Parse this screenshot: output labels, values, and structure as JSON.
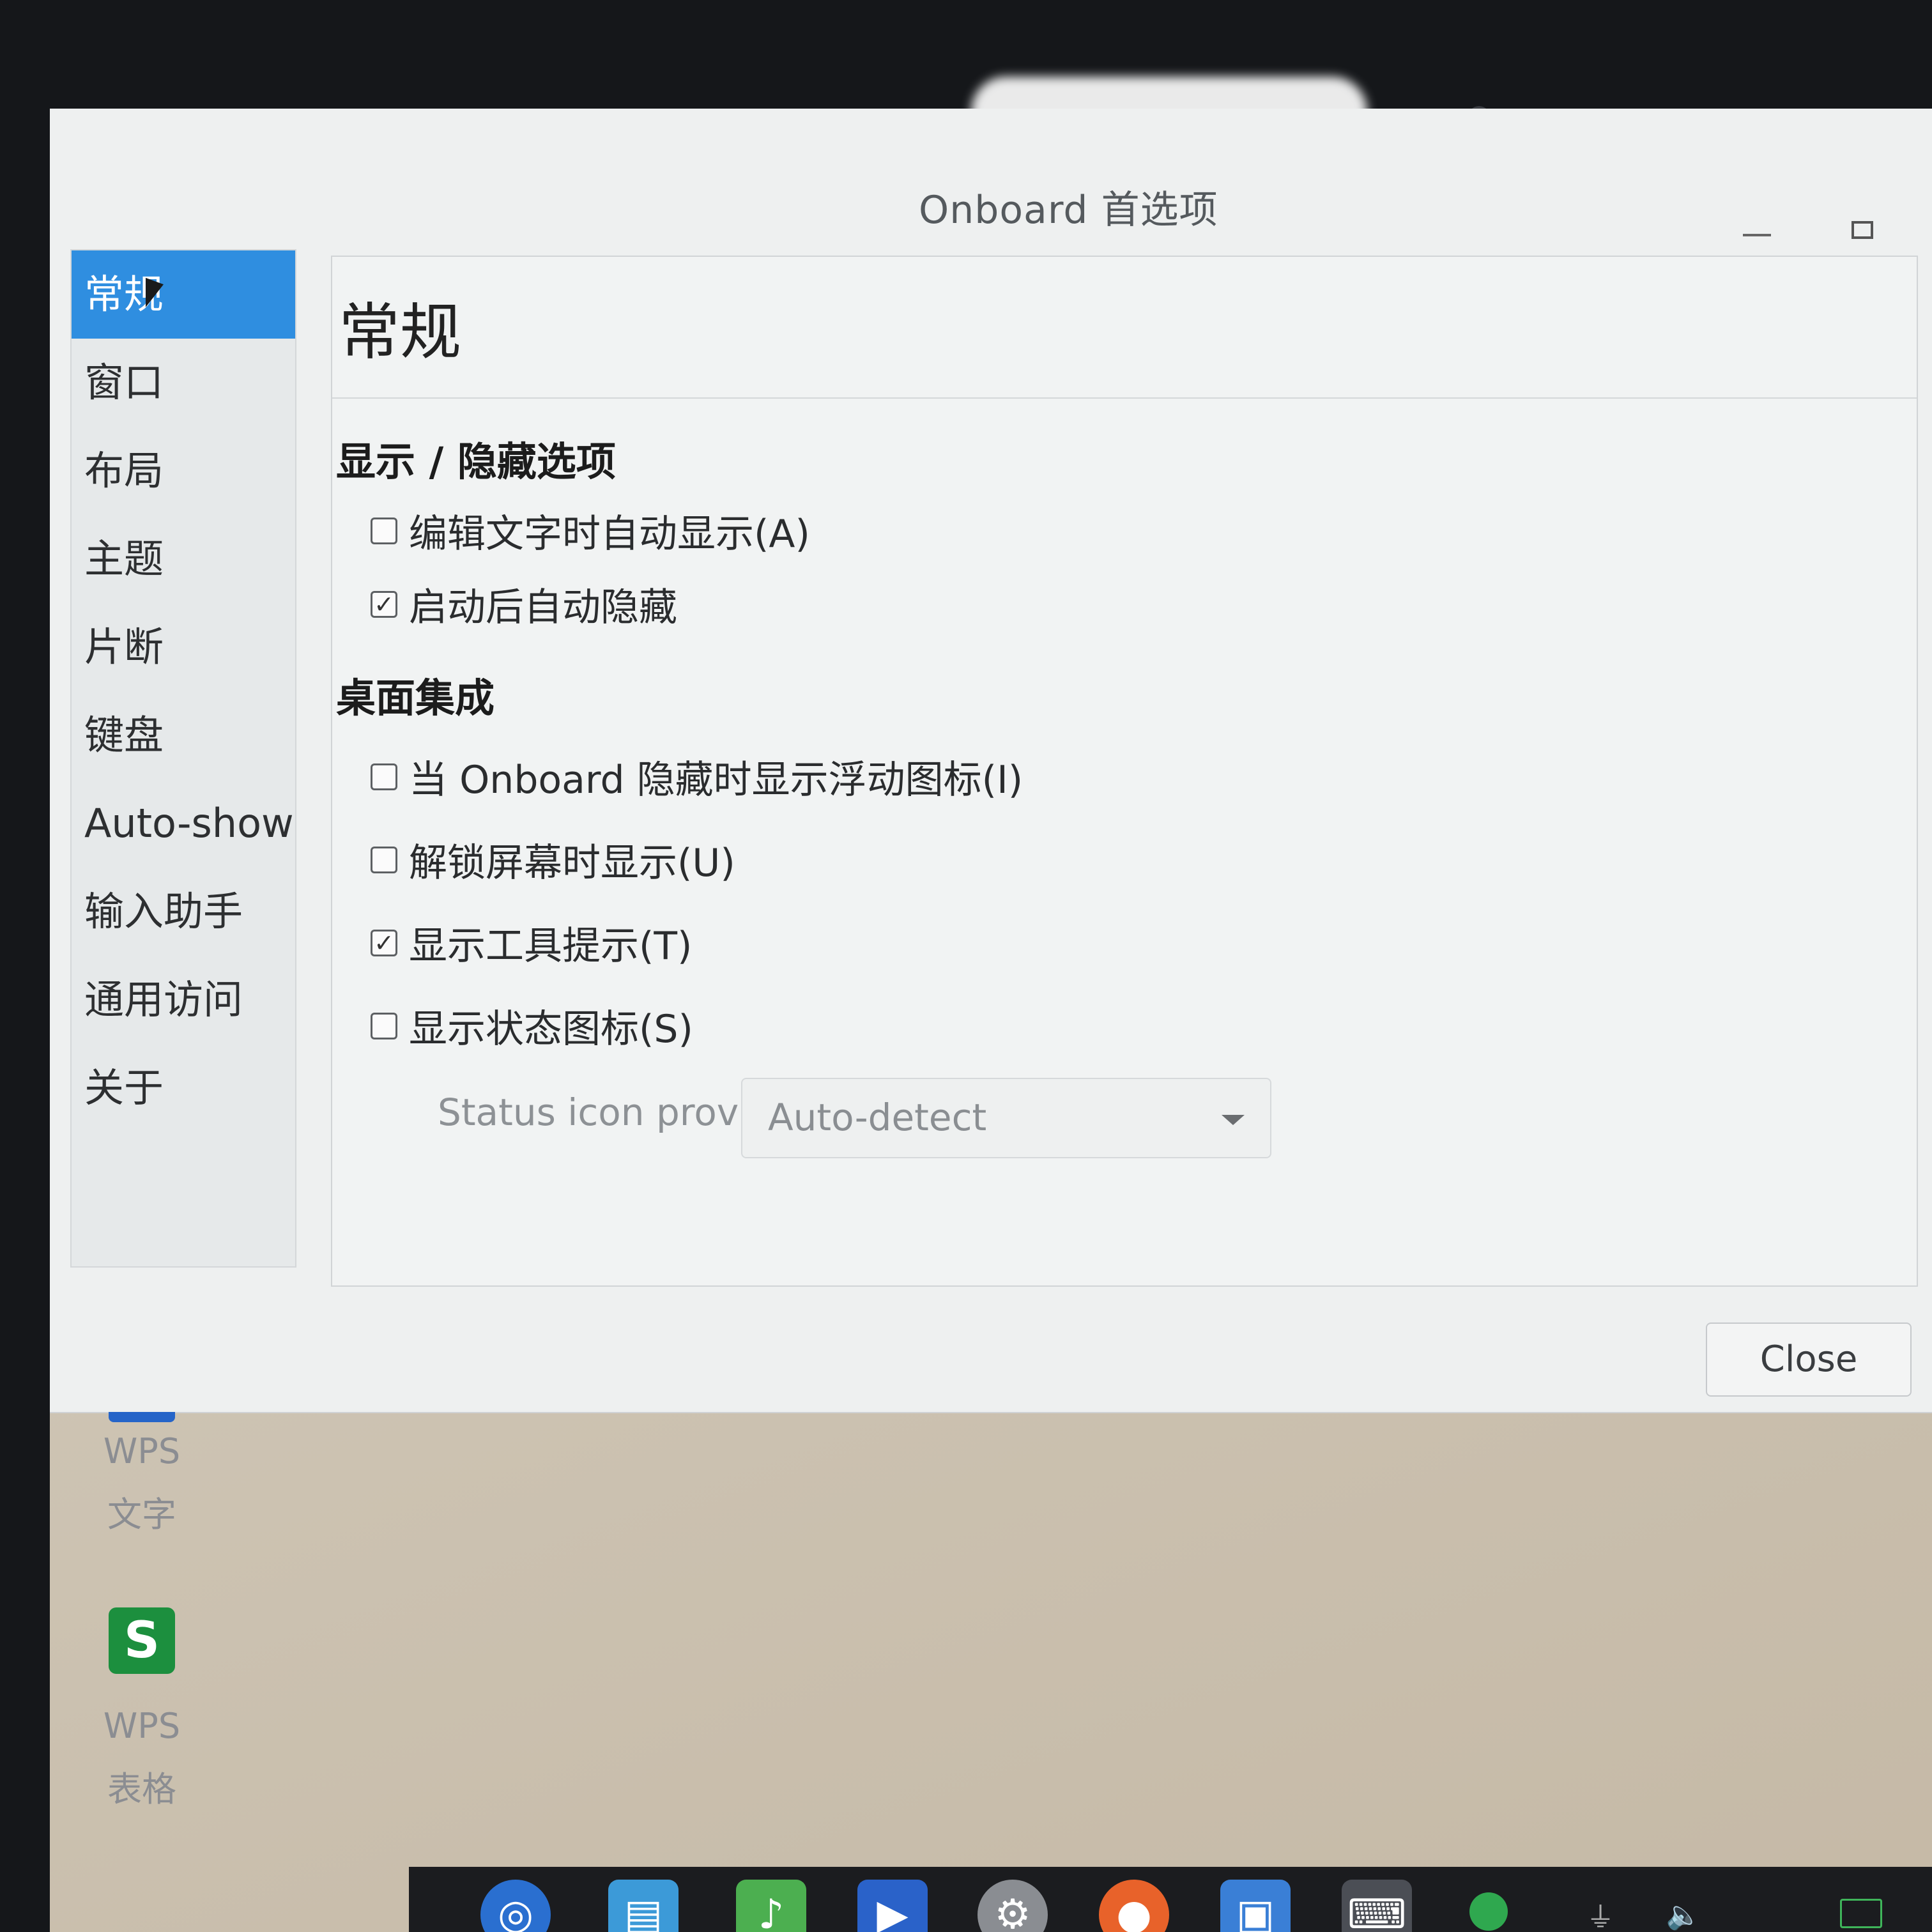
{
  "window": {
    "title": "Onboard 首选项",
    "minimize_label": "—",
    "maximize_label": ""
  },
  "sidebar": {
    "items": [
      {
        "label": "常规",
        "active": true
      },
      {
        "label": "窗口"
      },
      {
        "label": "布局"
      },
      {
        "label": "主题"
      },
      {
        "label": "片断"
      },
      {
        "label": "键盘"
      },
      {
        "label": "Auto-show"
      },
      {
        "label": "输入助手"
      },
      {
        "label": "通用访问"
      },
      {
        "label": "关于"
      }
    ]
  },
  "page": {
    "title": "常规",
    "sections": [
      {
        "title": "显示 / 隐藏选项",
        "options": [
          {
            "label": "编辑文字时自动显示(A)",
            "checked": false
          },
          {
            "label": "启动后自动隐藏",
            "checked": true
          }
        ]
      },
      {
        "title": "桌面集成",
        "options": [
          {
            "label": "当 Onboard 隐藏时显示浮动图标(I)",
            "checked": false
          },
          {
            "label": "解锁屏幕时显示(U)",
            "checked": false
          },
          {
            "label": "显示工具提示(T)",
            "checked": true
          },
          {
            "label": "显示状态图标(S)",
            "checked": false
          }
        ]
      }
    ],
    "status_icon_provider": {
      "label": "Status icon provider:",
      "value": "Auto-detect"
    }
  },
  "footer": {
    "close_label": "Close"
  },
  "desktop": {
    "icons": [
      {
        "name": "WPS 文字",
        "line1": "WPS",
        "line2": "文字"
      },
      {
        "name": "WPS 表格",
        "line1": "WPS",
        "line2": "表格",
        "glyph": "S"
      }
    ]
  },
  "taskbar": {
    "icons": [
      "launcher-icon",
      "file-manager-icon",
      "music-icon",
      "video-icon",
      "settings-icon",
      "firefox-icon",
      "workspace-icon",
      "keyboard-icon",
      "network-icon",
      "usb-icon",
      "volume-icon",
      "battery-icon"
    ]
  },
  "colors": {
    "accent": "#2f8ee0",
    "wps_green": "#1c8f3e",
    "taskbar": "#1b1c1f"
  }
}
